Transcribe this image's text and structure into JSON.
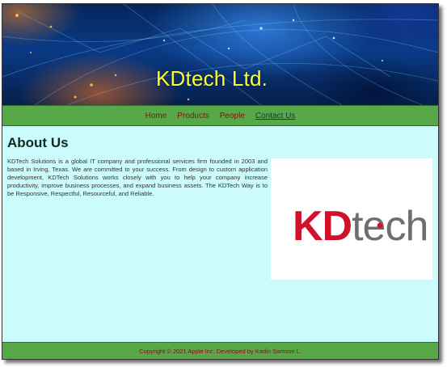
{
  "header": {
    "title": "KDtech Ltd."
  },
  "nav": {
    "items": [
      {
        "label": "Home",
        "active": false
      },
      {
        "label": "Products",
        "active": false
      },
      {
        "label": "People",
        "active": false
      },
      {
        "label": "Contact Us",
        "active": true
      }
    ]
  },
  "main": {
    "heading": "About Us",
    "paragraph": "KDTech Solutions is a global IT company and professional services firm founded in 2003 and based in Irving, Texas. We are committed to your success. From design to custom application development, KDTech Solutions works closely with you to help your company increase productivity, improve business processes, and expand business assets. The KDTech Way is to be Responsive, Respectful, Resourceful, and Reliable.",
    "logo": {
      "text_red": "KD",
      "text_gray": "tech",
      "color_red": "#d0112b",
      "color_gray": "#6e6e6e"
    }
  },
  "footer": {
    "text": "Copyright © 2021 Apple Inc. Developed by Kadin Samson L."
  },
  "colors": {
    "page_bg": "#ccfbfb",
    "nav_bg": "#56a848",
    "title": "#ffff33",
    "link": "#8b1010"
  }
}
